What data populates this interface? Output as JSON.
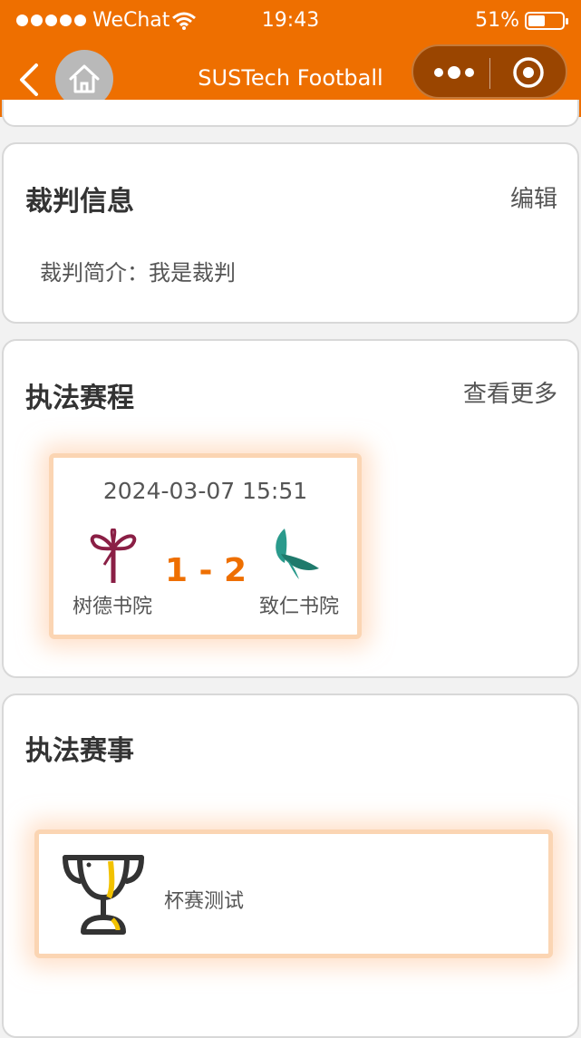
{
  "status_bar": {
    "carrier": "WeChat",
    "time": "19:43",
    "battery_text": "51%",
    "battery_level": 0.51
  },
  "nav": {
    "title": "SUSTech Football"
  },
  "referee_info": {
    "title": "裁判信息",
    "edit_label": "编辑",
    "intro": "裁判简介：我是裁判"
  },
  "schedule": {
    "title": "执法赛程",
    "more_label": "查看更多",
    "matches": [
      {
        "datetime": "2024-03-07 15:51",
        "home_team": "树德书院",
        "away_team": "致仁书院",
        "score": "1 - 2"
      }
    ]
  },
  "events": {
    "title": "执法赛事",
    "items": [
      {
        "name": "杯赛测试"
      }
    ]
  },
  "colors": {
    "accent": "#ee6f00",
    "card_glow": "#fbd5b3"
  },
  "icons": [
    "back-arrow-icon",
    "home-icon",
    "more-dots-icon",
    "close-target-icon",
    "shude-college-logo",
    "zhiren-college-logo",
    "trophy-icon",
    "wifi-icon",
    "battery-icon"
  ]
}
